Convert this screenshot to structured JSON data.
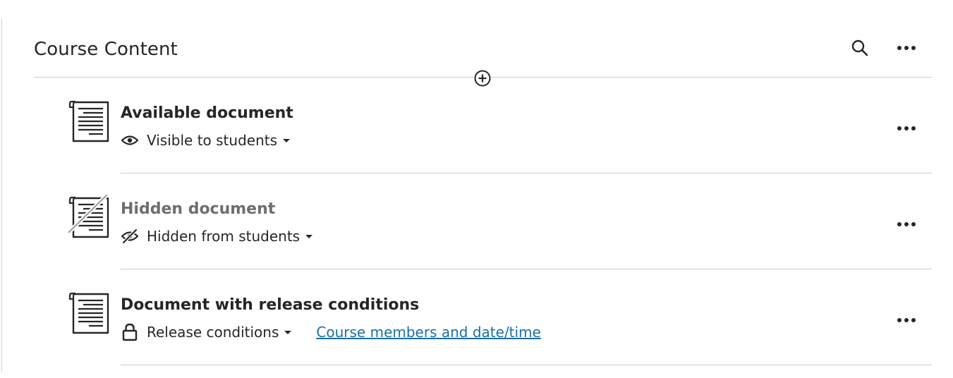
{
  "header": {
    "title": "Course Content",
    "search_icon": "search-icon",
    "more_icon": "more-horizontal-icon"
  },
  "add_icon": "add-circle-icon",
  "items": [
    {
      "title": "Available document",
      "status_label": "Visible to students",
      "status_icon": "eye-icon",
      "more_icon": "more-horizontal-icon"
    },
    {
      "title": "Hidden document",
      "status_label": "Hidden from students",
      "status_icon": "eye-slash-icon",
      "more_icon": "more-horizontal-icon"
    },
    {
      "title": "Document with release conditions",
      "status_label": "Release conditions",
      "status_icon": "lock-icon",
      "link_text": "Course members and date/time",
      "more_icon": "more-horizontal-icon"
    }
  ],
  "colors": {
    "text": "#262626",
    "muted_text": "#6e6e6e",
    "link": "#1c6fa0",
    "divider": "#cdcdcd"
  }
}
